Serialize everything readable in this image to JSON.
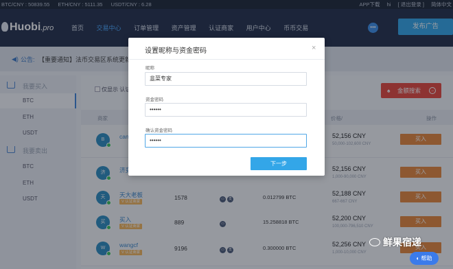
{
  "ticker": {
    "rates": [
      "BTC/CNY : 50839.55",
      "ETH/CNY : 5111.35",
      "USDT/CNY : 6.28"
    ],
    "app_download": "APP下载",
    "user": "hi",
    "logout": "[ 退出登录 ]",
    "language": "简体中文"
  },
  "header": {
    "logo_text": "Huobi",
    "logo_suffix": ".pro",
    "nav": [
      "首页",
      "交易中心",
      "订单管理",
      "资产管理",
      "认证商家",
      "用户中心",
      "币币交易"
    ],
    "active_nav": "交易中心",
    "publish_ad": "发布广告",
    "chat_icon": "chat-bubble-icon"
  },
  "notice": {
    "label": "公告:",
    "text": "【重要通知】法币交易区系统更新"
  },
  "sidebar": {
    "buy_section": "我要买入",
    "buy_items": [
      "BTC",
      "ETH",
      "USDT"
    ],
    "sell_section": "我要卖出",
    "sell_items": [
      "BTC",
      "ETH",
      "USDT"
    ],
    "active_item": "BTC"
  },
  "content": {
    "filter_label": "仅显示 认证",
    "search_button": "金额搜索",
    "table": {
      "col_merchant": "商家",
      "col_price": "价格/",
      "col_op": "操作"
    },
    "rows": [
      {
        "name": "can",
        "badge": "",
        "orders": "",
        "amount": "",
        "price": "52,156 CNY",
        "limit": "50,000-102,600 CNY",
        "action": "买入",
        "avatar": "B"
      },
      {
        "name": "济变",
        "badge": "",
        "orders": "",
        "amount": "",
        "price": "52,156 CNY",
        "limit": "1,000-90,000 CNY",
        "action": "买入",
        "avatar": "济"
      },
      {
        "name": "天大老板",
        "badge": "V 认证商家",
        "orders": "1578",
        "amount": "0.012799 BTC",
        "price": "52,188 CNY",
        "limit": "667-667 CNY",
        "action": "买入",
        "avatar": "天"
      },
      {
        "name": "买入",
        "badge": "V 认证商家",
        "orders": "889",
        "amount": "15.258818 BTC",
        "price": "52,200 CNY",
        "limit": "100,000-796,510 CNY",
        "action": "买入",
        "avatar": "买"
      },
      {
        "name": "wangcf",
        "badge": "V 认证商家",
        "orders": "9196",
        "amount": "0.300000 BTC",
        "price": "52,256 CNY",
        "limit": "1,000-10,000 CNY",
        "action": "买入",
        "avatar": "W"
      }
    ]
  },
  "modal": {
    "title": "设置昵称与资金密码",
    "close": "×",
    "nickname_label": "昵称",
    "nickname_value": "韭菜专家",
    "fund_password_label": "资金密码",
    "fund_password_value": "••••••",
    "confirm_password_label": "确认资金密码",
    "confirm_password_value": "••••••",
    "next_button": "下一步"
  },
  "watermark": "鲜果宿递",
  "help_button": "帮助"
}
